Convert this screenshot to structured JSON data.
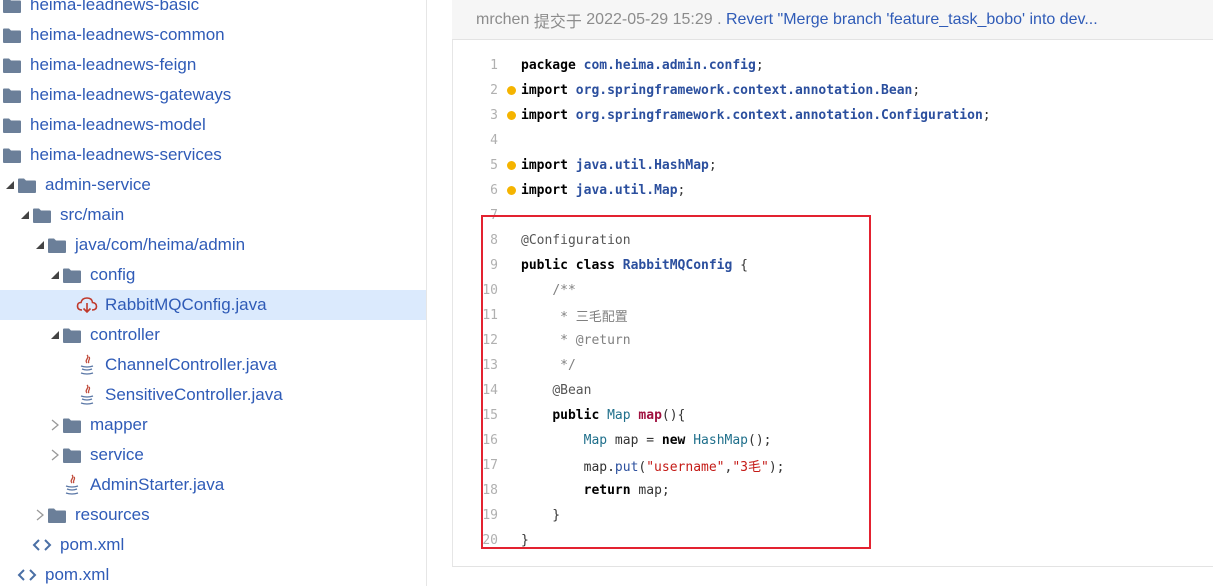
{
  "tree": [
    {
      "label": "heima-leadnews-basic",
      "level": 0,
      "type": "folder",
      "caret": "none"
    },
    {
      "label": "heima-leadnews-common",
      "level": 0,
      "type": "folder",
      "caret": "none"
    },
    {
      "label": "heima-leadnews-feign",
      "level": 0,
      "type": "folder",
      "caret": "none"
    },
    {
      "label": "heima-leadnews-gateways",
      "level": 0,
      "type": "folder",
      "caret": "none"
    },
    {
      "label": "heima-leadnews-model",
      "level": 0,
      "type": "folder",
      "caret": "none"
    },
    {
      "label": "heima-leadnews-services",
      "level": 0,
      "type": "folder",
      "caret": "none"
    },
    {
      "label": "admin-service",
      "level": 1,
      "type": "folder",
      "caret": "expanded"
    },
    {
      "label": "src/main",
      "level": 2,
      "type": "folder",
      "caret": "expanded"
    },
    {
      "label": "java/com/heima/admin",
      "level": 3,
      "type": "folder",
      "caret": "expanded"
    },
    {
      "label": "config",
      "level": 4,
      "type": "folder",
      "caret": "expanded"
    },
    {
      "label": "RabbitMQConfig.java",
      "level": 5,
      "type": "download-file",
      "caret": "none",
      "selected": true
    },
    {
      "label": "controller",
      "level": 4,
      "type": "folder",
      "caret": "expanded"
    },
    {
      "label": "ChannelController.java",
      "level": 5,
      "type": "java",
      "caret": "none"
    },
    {
      "label": "SensitiveController.java",
      "level": 5,
      "type": "java",
      "caret": "none"
    },
    {
      "label": "mapper",
      "level": 4,
      "type": "folder",
      "caret": "collapsed"
    },
    {
      "label": "service",
      "level": 4,
      "type": "folder",
      "caret": "collapsed"
    },
    {
      "label": "AdminStarter.java",
      "level": 4,
      "type": "java",
      "caret": "none"
    },
    {
      "label": "resources",
      "level": 3,
      "type": "folder",
      "caret": "collapsed"
    },
    {
      "label": "pom.xml",
      "level": 2,
      "type": "xml",
      "caret": "none"
    },
    {
      "label": "pom.xml",
      "level": 1,
      "type": "xml",
      "caret": "none"
    }
  ],
  "commit": {
    "author": "mrchen",
    "action": "提交于",
    "time": "2022-05-29 15:29",
    "separator": ".",
    "message": "Revert \"Merge branch 'feature_task_bobo' into dev..."
  },
  "code": {
    "lines": [
      {
        "n": "1",
        "marker": false,
        "tokens": [
          [
            "kw",
            "package"
          ],
          [
            "plain",
            " "
          ],
          [
            "pkg",
            "com.heima.admin.config"
          ],
          [
            "plain",
            ";"
          ]
        ]
      },
      {
        "n": "2",
        "marker": true,
        "tokens": [
          [
            "kw",
            "import"
          ],
          [
            "plain",
            " "
          ],
          [
            "pkg",
            "org.springframework.context.annotation.Bean"
          ],
          [
            "plain",
            ";"
          ]
        ]
      },
      {
        "n": "3",
        "marker": true,
        "tokens": [
          [
            "kw",
            "import"
          ],
          [
            "plain",
            " "
          ],
          [
            "pkg",
            "org.springframework.context.annotation.Configuration"
          ],
          [
            "plain",
            ";"
          ]
        ]
      },
      {
        "n": "4",
        "marker": false,
        "tokens": []
      },
      {
        "n": "5",
        "marker": true,
        "tokens": [
          [
            "kw",
            "import"
          ],
          [
            "plain",
            " "
          ],
          [
            "pkg",
            "java.util.HashMap"
          ],
          [
            "plain",
            ";"
          ]
        ]
      },
      {
        "n": "6",
        "marker": true,
        "tokens": [
          [
            "kw",
            "import"
          ],
          [
            "plain",
            " "
          ],
          [
            "pkg",
            "java.util.Map"
          ],
          [
            "plain",
            ";"
          ]
        ]
      },
      {
        "n": "7",
        "marker": false,
        "tokens": []
      },
      {
        "n": "8",
        "marker": false,
        "tokens": [
          [
            "an",
            "@Configuration"
          ]
        ]
      },
      {
        "n": "9",
        "marker": false,
        "tokens": [
          [
            "kw",
            "public class"
          ],
          [
            "plain",
            " "
          ],
          [
            "pkg",
            "RabbitMQConfig"
          ],
          [
            "plain",
            " {"
          ]
        ]
      },
      {
        "n": "10",
        "marker": false,
        "tokens": [
          [
            "plain",
            "    "
          ],
          [
            "cm",
            "/**"
          ]
        ]
      },
      {
        "n": "11",
        "marker": false,
        "tokens": [
          [
            "plain",
            "     "
          ],
          [
            "cm",
            "* 三毛配置"
          ]
        ]
      },
      {
        "n": "12",
        "marker": false,
        "tokens": [
          [
            "plain",
            "     "
          ],
          [
            "cm",
            "* @return"
          ]
        ]
      },
      {
        "n": "13",
        "marker": false,
        "tokens": [
          [
            "plain",
            "     "
          ],
          [
            "cm",
            "*/"
          ]
        ]
      },
      {
        "n": "14",
        "marker": false,
        "tokens": [
          [
            "plain",
            "    "
          ],
          [
            "an",
            "@Bean"
          ]
        ]
      },
      {
        "n": "15",
        "marker": false,
        "tokens": [
          [
            "plain",
            "    "
          ],
          [
            "kw",
            "public"
          ],
          [
            "plain",
            " "
          ],
          [
            "ty",
            "Map"
          ],
          [
            "plain",
            " "
          ],
          [
            "fn",
            "map"
          ],
          [
            "plain",
            "(){"
          ]
        ]
      },
      {
        "n": "16",
        "marker": false,
        "tokens": [
          [
            "plain",
            "        "
          ],
          [
            "ty",
            "Map"
          ],
          [
            "plain",
            " map = "
          ],
          [
            "kw",
            "new"
          ],
          [
            "plain",
            " "
          ],
          [
            "ty",
            "HashMap"
          ],
          [
            "plain",
            "();"
          ]
        ]
      },
      {
        "n": "17",
        "marker": false,
        "tokens": [
          [
            "plain",
            "        map."
          ],
          [
            "mt",
            "put"
          ],
          [
            "plain",
            "("
          ],
          [
            "str",
            "\"username\""
          ],
          [
            "plain",
            ","
          ],
          [
            "str",
            "\"3毛\""
          ],
          [
            "plain",
            ");"
          ]
        ]
      },
      {
        "n": "18",
        "marker": false,
        "tokens": [
          [
            "plain",
            "        "
          ],
          [
            "kw",
            "return"
          ],
          [
            "plain",
            " map;"
          ]
        ]
      },
      {
        "n": "19",
        "marker": false,
        "tokens": [
          [
            "plain",
            "    }"
          ]
        ]
      },
      {
        "n": "20",
        "marker": false,
        "tokens": [
          [
            "plain",
            "}"
          ]
        ]
      }
    ]
  },
  "colors": {
    "link": "#2f5bb7",
    "folder": "#6b7f99",
    "selected_bg": "#dbeafd",
    "highlight_border": "#e32230",
    "marker": "#f5b400"
  },
  "icons": {
    "folder": "folder-icon",
    "java": "java-file-icon",
    "xml": "xml-file-icon",
    "download-file": "cloud-download-icon",
    "expanded": "caret-expanded-icon",
    "collapsed": "caret-collapsed-icon"
  }
}
